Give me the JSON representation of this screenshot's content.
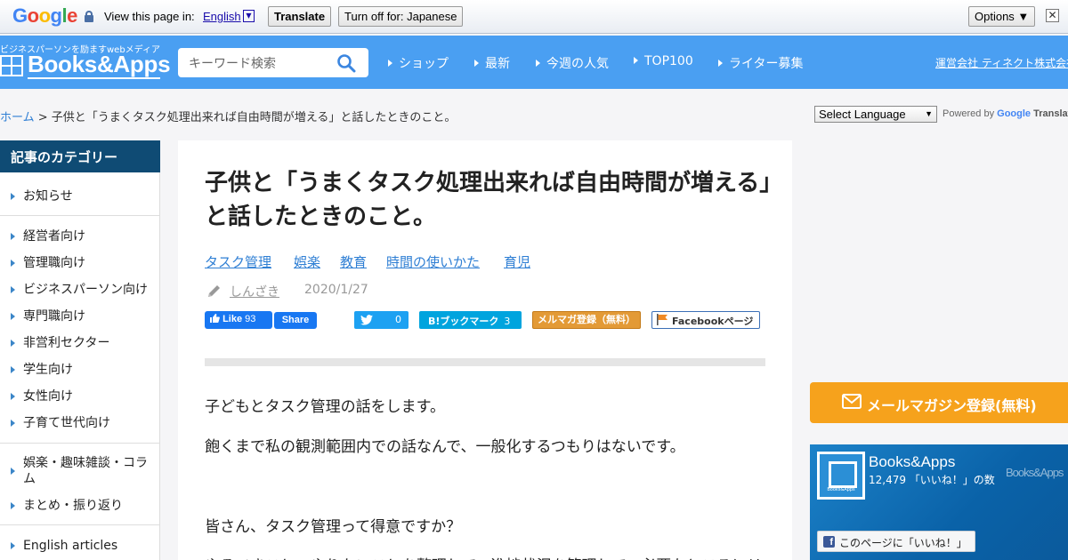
{
  "translate_bar": {
    "logo": "Google",
    "view_label": "View this page in:",
    "language": "English",
    "translate_button": "Translate",
    "turn_off_button": "Turn off for: Japanese",
    "options_button": "Options ▼",
    "close": "✕"
  },
  "header": {
    "tagline": "ビジネスパーソンを励ますwebメディア",
    "logo": "Books&Apps",
    "search_placeholder": "キーワード検索",
    "nav": [
      "ショップ",
      "最新",
      "今週の人気",
      "TOP100",
      "ライター募集"
    ],
    "company_link": "運営会社 ティネクト株式会社"
  },
  "breadcrumb": {
    "home": "ホーム",
    "separator": " > ",
    "current": "子供と「うまくタスク処理出来れば自由時間が増える」と話したときのこと。"
  },
  "language_select": {
    "selected": "Select Language",
    "powered_by": "Powered by",
    "google": "Google",
    "translate": "Translate"
  },
  "sidebar": {
    "title": "記事のカテゴリー",
    "items": [
      "お知らせ",
      "経営者向け",
      "管理職向け",
      "ビジネスパーソン向け",
      "専門職向け",
      "非営利セクター",
      "学生向け",
      "女性向け",
      "子育て世代向け",
      "娯楽・趣味雑談・コラム",
      "まとめ・振り返り",
      "English articles"
    ]
  },
  "article": {
    "title": "子供と「うまくタスク処理出来れば自由時間が増える」と話したときのこと。",
    "tags": [
      "タスク管理",
      "娯楽",
      "教育",
      "時間の使いかた",
      "育児"
    ],
    "author": "しんざき",
    "date": "2020/1/27",
    "share": {
      "like_label": "Like",
      "like_count": "93",
      "share_label": "Share",
      "tweet_count": "0",
      "hatena_label": "B!ブックマーク",
      "hatena_count": "3",
      "mailmag_label": "メルマガ登録（無料）",
      "facebook_page_label": "Facebookページ"
    },
    "paragraphs": [
      "子どもとタスク管理の話をします。",
      "飽くまで私の観測範囲内での話なんで、一般化するつもりはないです。",
      "皆さん、タスク管理って得意ですか？",
      "やるべきこと・やりたいことを整理して、進捗状況を管理して、必要なところにリ"
    ]
  },
  "right_column": {
    "mail_button": "メールマガジン登録(無料)",
    "facebook": {
      "page_name": "Books&Apps",
      "likes_text": "12,479 「いいね！」の数",
      "logo_caption": "Books&Apps",
      "watermark": "Books&Apps",
      "like_page_button": "このページに「いいね！」"
    }
  },
  "colors": {
    "header_blue": "#4a9ff2",
    "sidebar_navy": "#0f4b74",
    "link_blue": "#2f7fd4",
    "mail_orange": "#f6a21c",
    "facebook_blue": "#1877f2"
  }
}
